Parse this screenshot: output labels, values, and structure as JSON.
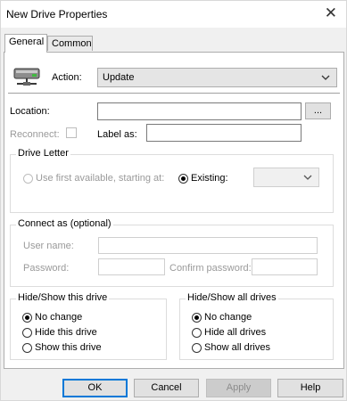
{
  "window": {
    "title": "New Drive Properties",
    "close_glyph": "✕"
  },
  "tabs": [
    {
      "label": "General",
      "active": true
    },
    {
      "label": "Common",
      "active": false
    }
  ],
  "general": {
    "action_label": "Action:",
    "action_value": "Update",
    "location_label": "Location:",
    "location_value": "",
    "browse_label": "...",
    "reconnect_label": "Reconnect:",
    "reconnect_checked": false,
    "label_as_label": "Label as:",
    "label_as_value": "",
    "drive_letter": {
      "title": "Drive Letter",
      "use_first_label": "Use first available, starting at:",
      "existing_label": "Existing:",
      "existing_value": ""
    },
    "connect_as": {
      "title": "Connect as (optional)",
      "username_label": "User name:",
      "password_label": "Password:",
      "confirm_password_label": "Confirm password:"
    },
    "hide_show_drive": {
      "title": "Hide/Show this drive",
      "options": [
        "No change",
        "Hide this drive",
        "Show this drive"
      ],
      "selected": 0
    },
    "hide_show_all": {
      "title": "Hide/Show all drives",
      "options": [
        "No change",
        "Hide all drives",
        "Show all drives"
      ],
      "selected": 0
    }
  },
  "buttons": {
    "ok": "OK",
    "cancel": "Cancel",
    "apply": "Apply",
    "help": "Help"
  },
  "colors": {
    "accent": "#0078d7",
    "window_bg": "#f0f0f0",
    "panel_bg": "#ffffff",
    "disabled_text": "#9a9a9a"
  }
}
